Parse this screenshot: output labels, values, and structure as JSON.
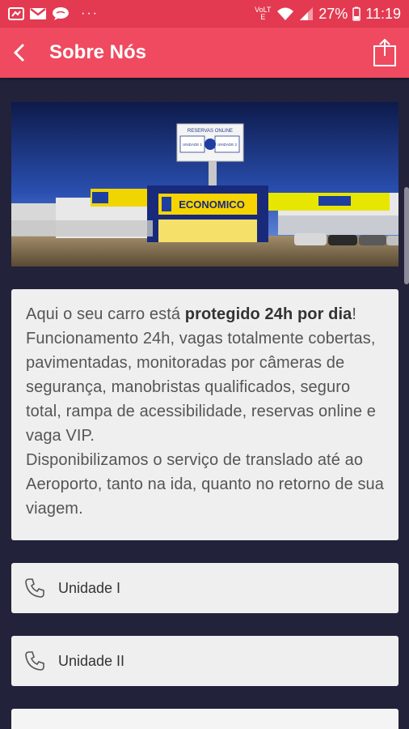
{
  "status_bar": {
    "carrier_small": "VoLTE",
    "battery": "27%",
    "time": "11:19",
    "icons": [
      "notification-icon",
      "gmail-icon",
      "chat-bubble-icon",
      "more-dots-icon",
      "signal-icon",
      "wifi-icon",
      "battery-icon"
    ]
  },
  "app_bar": {
    "title": "Sobre Nós",
    "back_icon": "chevron-left-icon",
    "share_icon": "share-icon",
    "color": "#ef4a5f"
  },
  "hero": {
    "sign_line1": "RESERVAS ONLINE",
    "building_name": "ECONOMICO",
    "sub_left": "UNIDADE 1",
    "sub_right": "UNIDADE 2"
  },
  "about": {
    "intro_prefix": "Aqui o seu carro está ",
    "intro_bold": "protegido 24h por dia",
    "intro_suffix": "!",
    "body": "Funcionamento 24h, vagas totalmente cobertas, pavimentadas, monitoradas por câmeras de segurança, manobristas qualificados, seguro total, rampa de acessibilidade, reservas online e vaga VIP.",
    "body2": "Disponibilizamos o serviço de translado até ao Aeroporto, tanto na ida, quanto no retorno de sua viagem."
  },
  "units": [
    {
      "label": "Unidade I",
      "icon": "phone-icon"
    },
    {
      "label": "Unidade II",
      "icon": "phone-icon"
    }
  ]
}
